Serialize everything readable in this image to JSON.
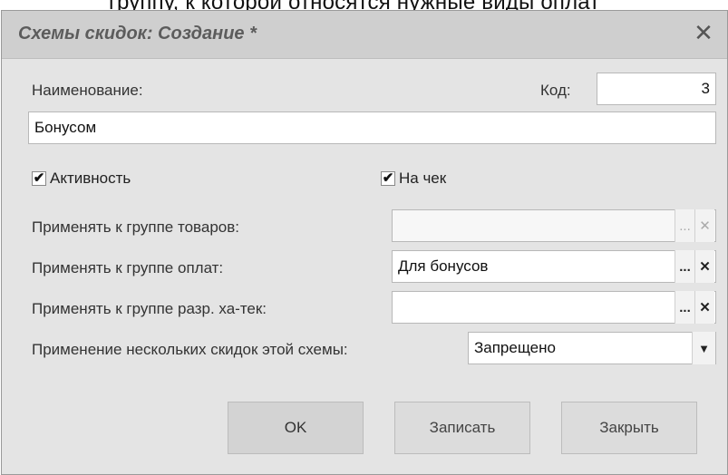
{
  "page": {
    "top_text": "группу, к которой относятся нужные виды оплат"
  },
  "dialog": {
    "title": "Схемы скидок: Создание *",
    "close_glyph": "✕"
  },
  "fields": {
    "name_label": "Наименование:",
    "code_label": "Код:",
    "code_value": "3",
    "name_value": "Бонусом",
    "active_label": "Активность",
    "active_checked": true,
    "on_receipt_label": "На чек",
    "on_receipt_checked": true,
    "goods_group_label": "Применять к группе товаров:",
    "goods_group_value": "",
    "payment_group_label": "Применять к группе оплат:",
    "payment_group_value": "Для бонусов",
    "char_group_label": "Применять к группе разр. ха-тек:",
    "char_group_value": "",
    "multi_label": "Применение нескольких скидок этой схемы:",
    "multi_value": "Запрещено"
  },
  "controls": {
    "ellipsis": "...",
    "clear": "✕",
    "check": "✔",
    "dropdown": "▼"
  },
  "buttons": {
    "ok": "OK",
    "save": "Записать",
    "close": "Закрыть"
  }
}
